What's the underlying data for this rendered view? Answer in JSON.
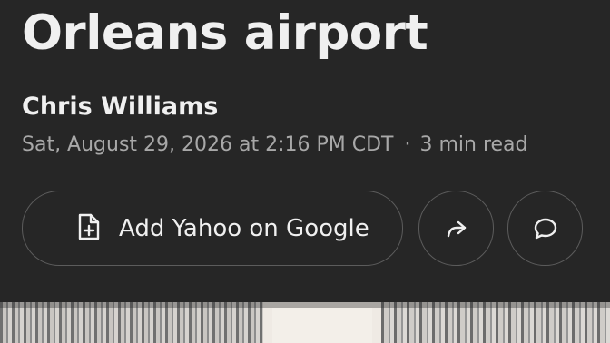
{
  "article": {
    "title": "Orleans airport",
    "author": "Chris Williams",
    "date": "Sat, August 29, 2026 at 2:16 PM CDT",
    "separator": "·",
    "read_time": "3 min read"
  },
  "actions": {
    "add_source_label": "Add Yahoo on Google",
    "add_source_icon": "add-document-icon",
    "share_icon": "share-arrow-icon",
    "comment_icon": "comment-bubble-icon"
  },
  "colors": {
    "background": "#262626",
    "text_primary": "#f0f0f0",
    "text_secondary": "#a8a8a8",
    "button_border": "#5c5c5c"
  }
}
